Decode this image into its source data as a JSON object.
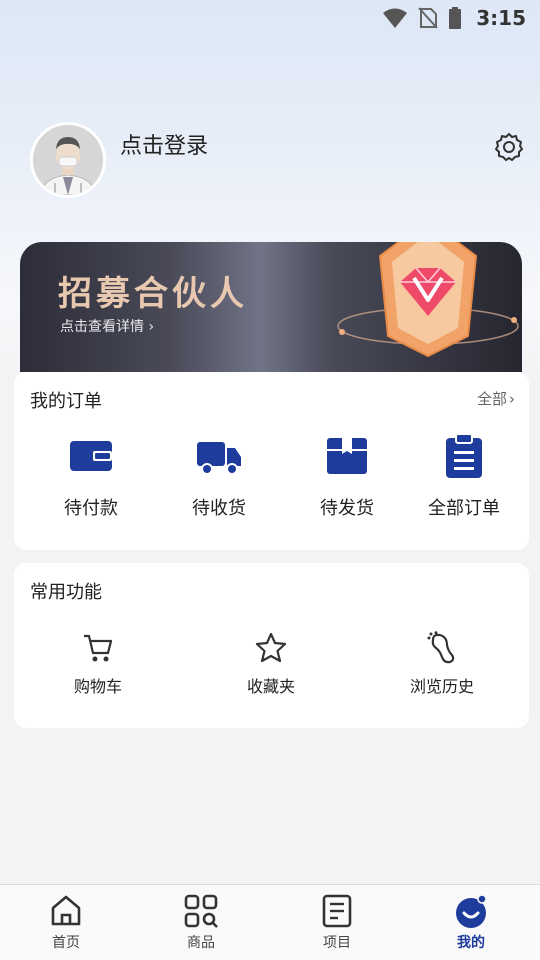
{
  "status_bar": {
    "time": "3:15"
  },
  "profile": {
    "login_text": "点击登录"
  },
  "banner": {
    "title": "招募合伙人",
    "subtitle": "点击查看详情"
  },
  "orders": {
    "title": "我的订单",
    "more_label": "全部",
    "items": [
      {
        "label": "待付款",
        "icon": "wallet-icon"
      },
      {
        "label": "待收货",
        "icon": "truck-icon"
      },
      {
        "label": "待发货",
        "icon": "package-icon"
      },
      {
        "label": "全部订单",
        "icon": "clipboard-icon"
      }
    ]
  },
  "functions": {
    "title": "常用功能",
    "items": [
      {
        "label": "购物车",
        "icon": "cart-icon"
      },
      {
        "label": "收藏夹",
        "icon": "star-icon"
      },
      {
        "label": "浏览历史",
        "icon": "footprint-icon"
      }
    ]
  },
  "tabbar": {
    "items": [
      {
        "label": "首页",
        "icon": "home-icon"
      },
      {
        "label": "商品",
        "icon": "grid-search-icon"
      },
      {
        "label": "项目",
        "icon": "document-icon"
      },
      {
        "label": "我的",
        "icon": "profile-face-icon",
        "active": true
      }
    ]
  },
  "colors": {
    "accent": "#1e3c9c",
    "banner_title": "#e9c8b0"
  }
}
